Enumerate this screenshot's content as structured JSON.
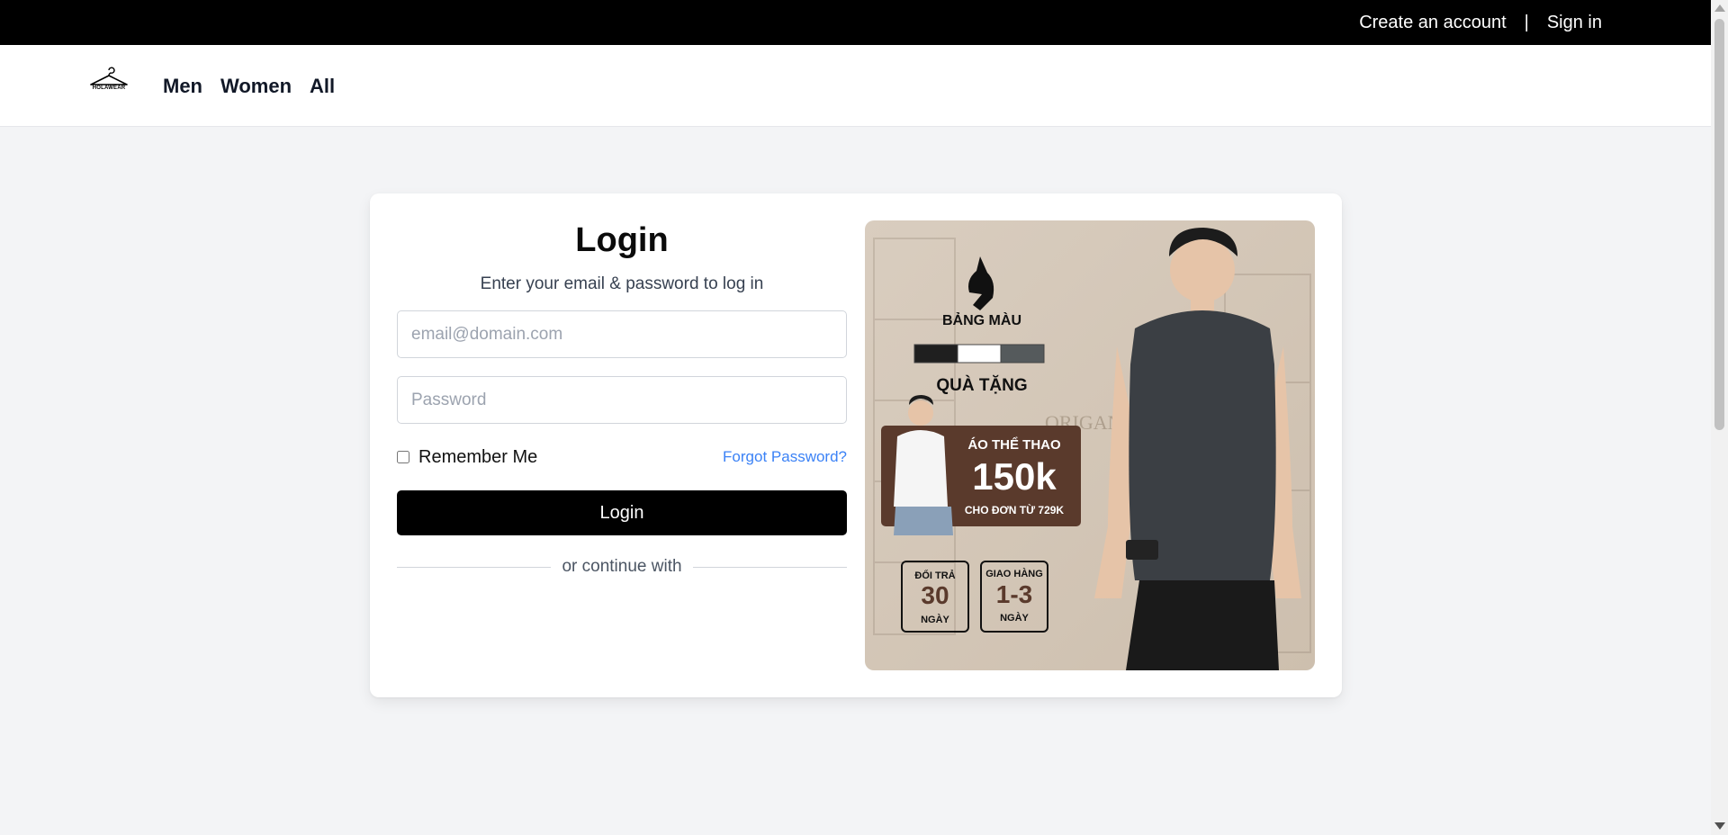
{
  "topbar": {
    "create_account": "Create an account",
    "separator": "|",
    "sign_in": "Sign in"
  },
  "nav": {
    "logo_text": "HOLAWEAR",
    "links": [
      "Men",
      "Women",
      "All"
    ]
  },
  "login": {
    "title": "Login",
    "subtitle": "Enter your email & password to log in",
    "email_placeholder": "email@domain.com",
    "password_placeholder": "Password",
    "remember_label": "Remember Me",
    "forgot_label": "Forgot Password?",
    "button_label": "Login",
    "divider_text": "or continue with"
  },
  "promo": {
    "palette_title": "BẢNG MÀU",
    "gift_title": "QUÀ TẶNG",
    "product": "ÁO THỂ THAO",
    "price": "150k",
    "condition": "CHO ĐƠN TỪ 729K",
    "return_label": "ĐỔI TRẢ",
    "return_value": "30",
    "return_unit": "NGÀY",
    "ship_label": "GIAO HÀNG",
    "ship_value": "1-3",
    "ship_unit": "NGÀY",
    "watermark": "ORIGANO",
    "swatches": [
      "#1f1f1f",
      "#ffffff",
      "#555a5c"
    ]
  },
  "colors": {
    "topbar_bg": "#000000",
    "page_bg": "#f3f4f6",
    "link_blue": "#3b82f6",
    "promo_bg": "#d8ccbd",
    "promo_badge": "#5a3a2c"
  }
}
